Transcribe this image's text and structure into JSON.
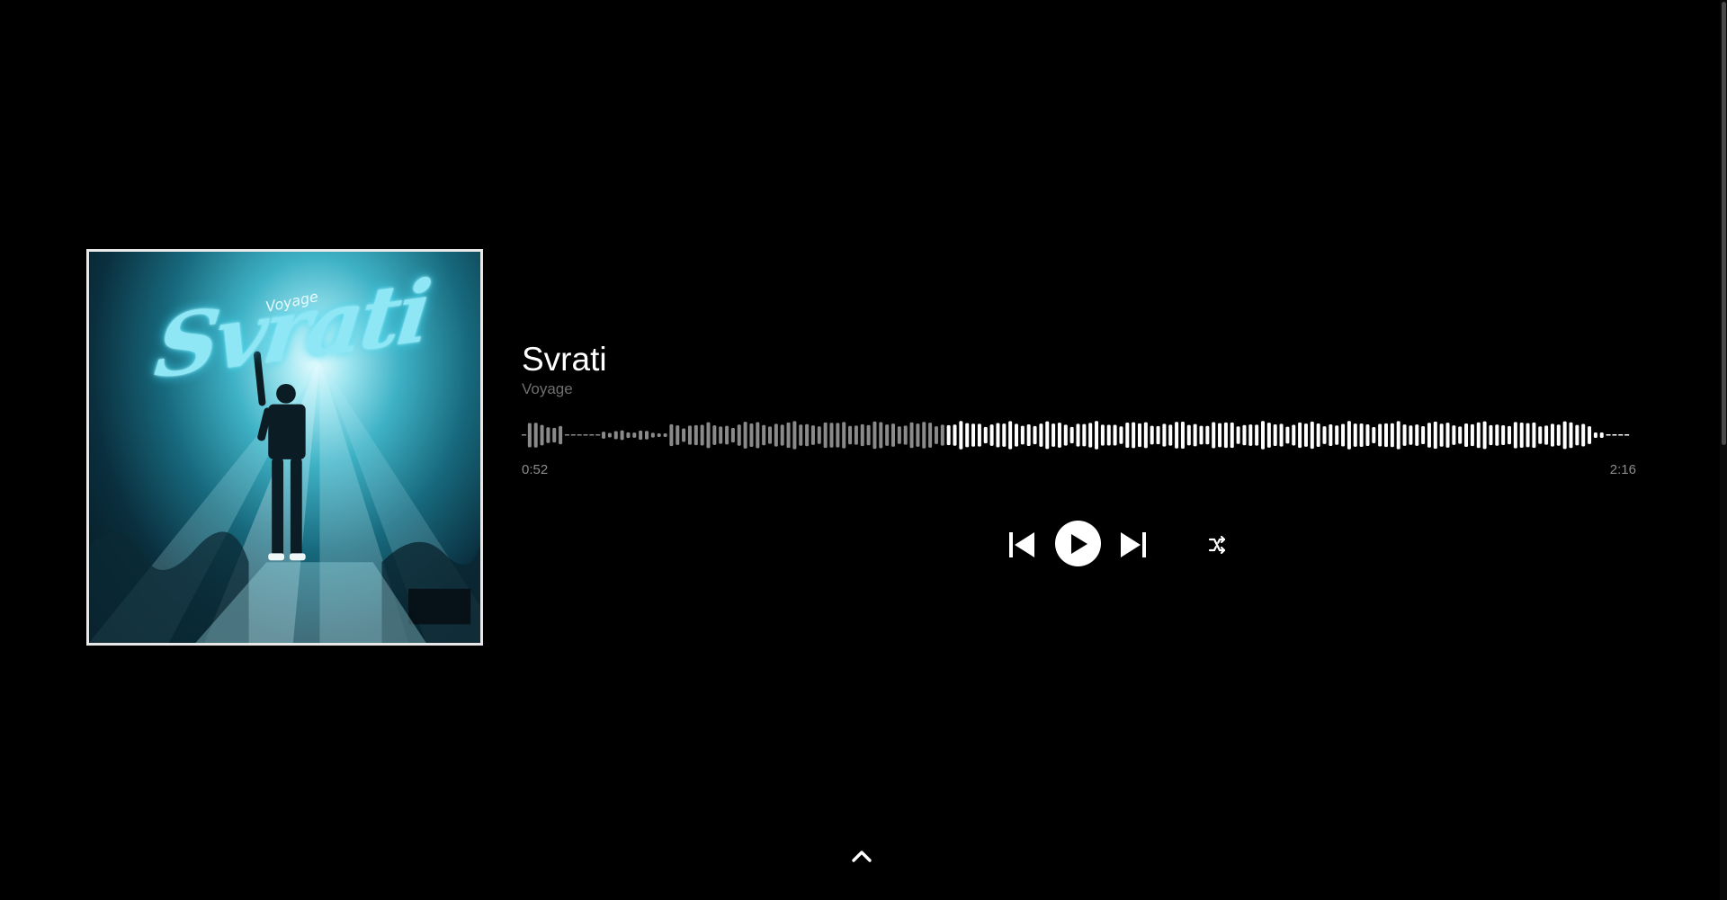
{
  "track": {
    "title": "Svrati",
    "artist": "Voyage"
  },
  "cover": {
    "wordmark": "Svrati",
    "subword": "Voyage"
  },
  "playback": {
    "elapsed": "0:52",
    "total": "2:16",
    "progress": 0.38
  },
  "controls": {
    "previous_icon": "skip-previous-icon",
    "play_icon": "play-icon",
    "next_icon": "skip-next-icon",
    "shuffle_icon": "shuffle-icon",
    "expand_icon": "chevron-up-icon"
  },
  "colors": {
    "background": "#000000",
    "played": "#8a8a8a",
    "unplayed": "#ffffff",
    "muted_text": "#6f6f6f"
  }
}
